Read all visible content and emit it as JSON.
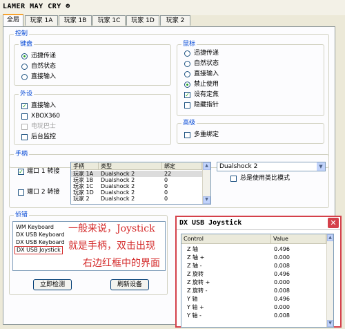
{
  "app": {
    "title": "LAMER MAY CRY ☻"
  },
  "tabs": [
    "全局",
    "玩家 1A",
    "玩家 1B",
    "玩家 1C",
    "玩家 1D",
    "玩家 2"
  ],
  "control": {
    "legend": "控制",
    "keyboard": {
      "legend": "键盘",
      "options": [
        "迅捷传递",
        "自然状态",
        "直接输入"
      ],
      "selected": 0
    },
    "peripheral": {
      "legend": "外设",
      "items": [
        {
          "label": "直接输入",
          "checked": true,
          "enabled": true
        },
        {
          "label": "XBOX360",
          "checked": false,
          "enabled": true
        },
        {
          "label": "电玩巴士",
          "checked": false,
          "enabled": false
        },
        {
          "label": "后台监控",
          "checked": false,
          "enabled": true
        }
      ]
    },
    "mouse": {
      "legend": "鼠标",
      "options": [
        "迅捷传递",
        "自然状态",
        "直接输入",
        "禁止使用"
      ],
      "selected": 3,
      "checks": [
        {
          "label": "设有定焦",
          "checked": true
        },
        {
          "label": "隐藏指针",
          "checked": false
        }
      ]
    },
    "advanced": {
      "legend": "高级",
      "checks": [
        {
          "label": "多重绑定",
          "checked": false
        }
      ]
    }
  },
  "gamepad": {
    "legend": "手柄",
    "ports": [
      {
        "label": "端口 1 转接",
        "checked": true
      },
      {
        "label": "端口 2 转接",
        "checked": false
      }
    ],
    "columns": [
      "手柄",
      "类型",
      "绑定"
    ],
    "rows": [
      [
        "玩家 1A",
        "Dualshock 2",
        "22"
      ],
      [
        "玩家 1B",
        "Dualshock 2",
        "0"
      ],
      [
        "玩家 1C",
        "Dualshock 2",
        "0"
      ],
      [
        "玩家 1D",
        "Dualshock 2",
        "0"
      ],
      [
        "玩家 2",
        "Dualshock 2",
        "0"
      ]
    ],
    "device_select": "Dualshock 2",
    "always_analog": "总是使用类比模式"
  },
  "devices": {
    "legend": "侦错",
    "items": [
      "WM Keyboard",
      "DX USB Keyboard",
      "DX USB Keyboard",
      "DX USB Joystick"
    ],
    "detect_button": "立即检测",
    "refresh_button": "刷新设备"
  },
  "annotation": {
    "lines": [
      "一般来说，Joystick",
      "就是手柄，双击出现",
      "右边红框中的界面"
    ]
  },
  "joystick_window": {
    "title": "DX USB Joystick",
    "columns": [
      "Control",
      "Value"
    ],
    "rows": [
      [
        "Z 轴",
        "0.496"
      ],
      [
        "Z 轴 +",
        "0.000"
      ],
      [
        "Z 轴 -",
        "0.008"
      ],
      [
        "Z 旋转",
        "0.496"
      ],
      [
        "Z 旋转 +",
        "0.000"
      ],
      [
        "Z 旋转 -",
        "0.008"
      ],
      [
        "Y 轴",
        "0.496"
      ],
      [
        "Y 轴 +",
        "0.000"
      ],
      [
        "Y 轴 -",
        "0.008"
      ]
    ]
  },
  "colors": {
    "accent": "#0046d5",
    "highlight": "#d42a2a",
    "close": "#d4404a"
  }
}
